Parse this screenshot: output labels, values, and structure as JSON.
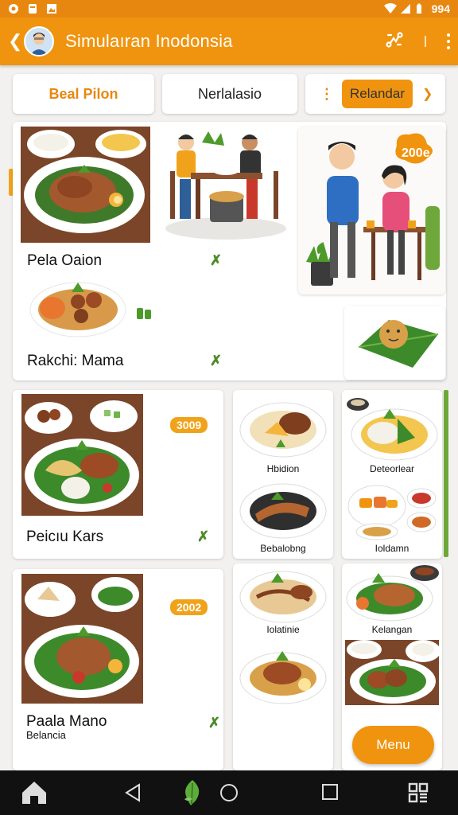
{
  "status_bar": {
    "time": "994",
    "icons": [
      "notification-icon",
      "app-icon",
      "wifi-icon",
      "signal-icon",
      "battery-icon"
    ]
  },
  "app_bar": {
    "title": "Simulaıran Inodonsia",
    "actions": [
      "route-icon",
      "more-icon"
    ]
  },
  "tabs": [
    {
      "label": "Beal Pilon"
    },
    {
      "label": "Nerlalasio"
    },
    {
      "label": "Relandar"
    }
  ],
  "dishes": [
    {
      "name": "Pela Oaion"
    },
    {
      "name": "Rakchi: Mama"
    },
    {
      "name": "Peicıu Kars",
      "price": "3009"
    },
    {
      "name": "Paala Mano",
      "sub": "Belancia",
      "price": "2002"
    }
  ],
  "promo": {
    "badge": "200e"
  },
  "tiles": [
    {
      "label": "Hbidion"
    },
    {
      "label": "Deteorlear"
    },
    {
      "label": "Bebalobng"
    },
    {
      "label": "Ioldamn"
    },
    {
      "label": "Iolatinie"
    },
    {
      "label": "Kelangan"
    }
  ],
  "menu_button": {
    "label": "Menu"
  },
  "colors": {
    "brand": "#f0940f",
    "accent_green": "#4b8b23"
  }
}
